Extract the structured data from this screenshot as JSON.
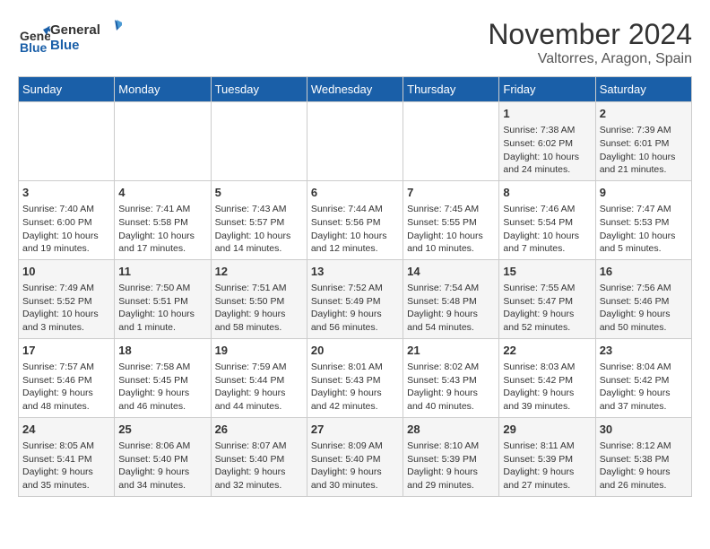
{
  "header": {
    "logo_line1": "General",
    "logo_line2": "Blue",
    "month": "November 2024",
    "location": "Valtorres, Aragon, Spain"
  },
  "days_of_week": [
    "Sunday",
    "Monday",
    "Tuesday",
    "Wednesday",
    "Thursday",
    "Friday",
    "Saturday"
  ],
  "weeks": [
    [
      {
        "day": "",
        "info": ""
      },
      {
        "day": "",
        "info": ""
      },
      {
        "day": "",
        "info": ""
      },
      {
        "day": "",
        "info": ""
      },
      {
        "day": "",
        "info": ""
      },
      {
        "day": "1",
        "info": "Sunrise: 7:38 AM\nSunset: 6:02 PM\nDaylight: 10 hours and 24 minutes."
      },
      {
        "day": "2",
        "info": "Sunrise: 7:39 AM\nSunset: 6:01 PM\nDaylight: 10 hours and 21 minutes."
      }
    ],
    [
      {
        "day": "3",
        "info": "Sunrise: 7:40 AM\nSunset: 6:00 PM\nDaylight: 10 hours and 19 minutes."
      },
      {
        "day": "4",
        "info": "Sunrise: 7:41 AM\nSunset: 5:58 PM\nDaylight: 10 hours and 17 minutes."
      },
      {
        "day": "5",
        "info": "Sunrise: 7:43 AM\nSunset: 5:57 PM\nDaylight: 10 hours and 14 minutes."
      },
      {
        "day": "6",
        "info": "Sunrise: 7:44 AM\nSunset: 5:56 PM\nDaylight: 10 hours and 12 minutes."
      },
      {
        "day": "7",
        "info": "Sunrise: 7:45 AM\nSunset: 5:55 PM\nDaylight: 10 hours and 10 minutes."
      },
      {
        "day": "8",
        "info": "Sunrise: 7:46 AM\nSunset: 5:54 PM\nDaylight: 10 hours and 7 minutes."
      },
      {
        "day": "9",
        "info": "Sunrise: 7:47 AM\nSunset: 5:53 PM\nDaylight: 10 hours and 5 minutes."
      }
    ],
    [
      {
        "day": "10",
        "info": "Sunrise: 7:49 AM\nSunset: 5:52 PM\nDaylight: 10 hours and 3 minutes."
      },
      {
        "day": "11",
        "info": "Sunrise: 7:50 AM\nSunset: 5:51 PM\nDaylight: 10 hours and 1 minute."
      },
      {
        "day": "12",
        "info": "Sunrise: 7:51 AM\nSunset: 5:50 PM\nDaylight: 9 hours and 58 minutes."
      },
      {
        "day": "13",
        "info": "Sunrise: 7:52 AM\nSunset: 5:49 PM\nDaylight: 9 hours and 56 minutes."
      },
      {
        "day": "14",
        "info": "Sunrise: 7:54 AM\nSunset: 5:48 PM\nDaylight: 9 hours and 54 minutes."
      },
      {
        "day": "15",
        "info": "Sunrise: 7:55 AM\nSunset: 5:47 PM\nDaylight: 9 hours and 52 minutes."
      },
      {
        "day": "16",
        "info": "Sunrise: 7:56 AM\nSunset: 5:46 PM\nDaylight: 9 hours and 50 minutes."
      }
    ],
    [
      {
        "day": "17",
        "info": "Sunrise: 7:57 AM\nSunset: 5:46 PM\nDaylight: 9 hours and 48 minutes."
      },
      {
        "day": "18",
        "info": "Sunrise: 7:58 AM\nSunset: 5:45 PM\nDaylight: 9 hours and 46 minutes."
      },
      {
        "day": "19",
        "info": "Sunrise: 7:59 AM\nSunset: 5:44 PM\nDaylight: 9 hours and 44 minutes."
      },
      {
        "day": "20",
        "info": "Sunrise: 8:01 AM\nSunset: 5:43 PM\nDaylight: 9 hours and 42 minutes."
      },
      {
        "day": "21",
        "info": "Sunrise: 8:02 AM\nSunset: 5:43 PM\nDaylight: 9 hours and 40 minutes."
      },
      {
        "day": "22",
        "info": "Sunrise: 8:03 AM\nSunset: 5:42 PM\nDaylight: 9 hours and 39 minutes."
      },
      {
        "day": "23",
        "info": "Sunrise: 8:04 AM\nSunset: 5:42 PM\nDaylight: 9 hours and 37 minutes."
      }
    ],
    [
      {
        "day": "24",
        "info": "Sunrise: 8:05 AM\nSunset: 5:41 PM\nDaylight: 9 hours and 35 minutes."
      },
      {
        "day": "25",
        "info": "Sunrise: 8:06 AM\nSunset: 5:40 PM\nDaylight: 9 hours and 34 minutes."
      },
      {
        "day": "26",
        "info": "Sunrise: 8:07 AM\nSunset: 5:40 PM\nDaylight: 9 hours and 32 minutes."
      },
      {
        "day": "27",
        "info": "Sunrise: 8:09 AM\nSunset: 5:40 PM\nDaylight: 9 hours and 30 minutes."
      },
      {
        "day": "28",
        "info": "Sunrise: 8:10 AM\nSunset: 5:39 PM\nDaylight: 9 hours and 29 minutes."
      },
      {
        "day": "29",
        "info": "Sunrise: 8:11 AM\nSunset: 5:39 PM\nDaylight: 9 hours and 27 minutes."
      },
      {
        "day": "30",
        "info": "Sunrise: 8:12 AM\nSunset: 5:38 PM\nDaylight: 9 hours and 26 minutes."
      }
    ]
  ]
}
